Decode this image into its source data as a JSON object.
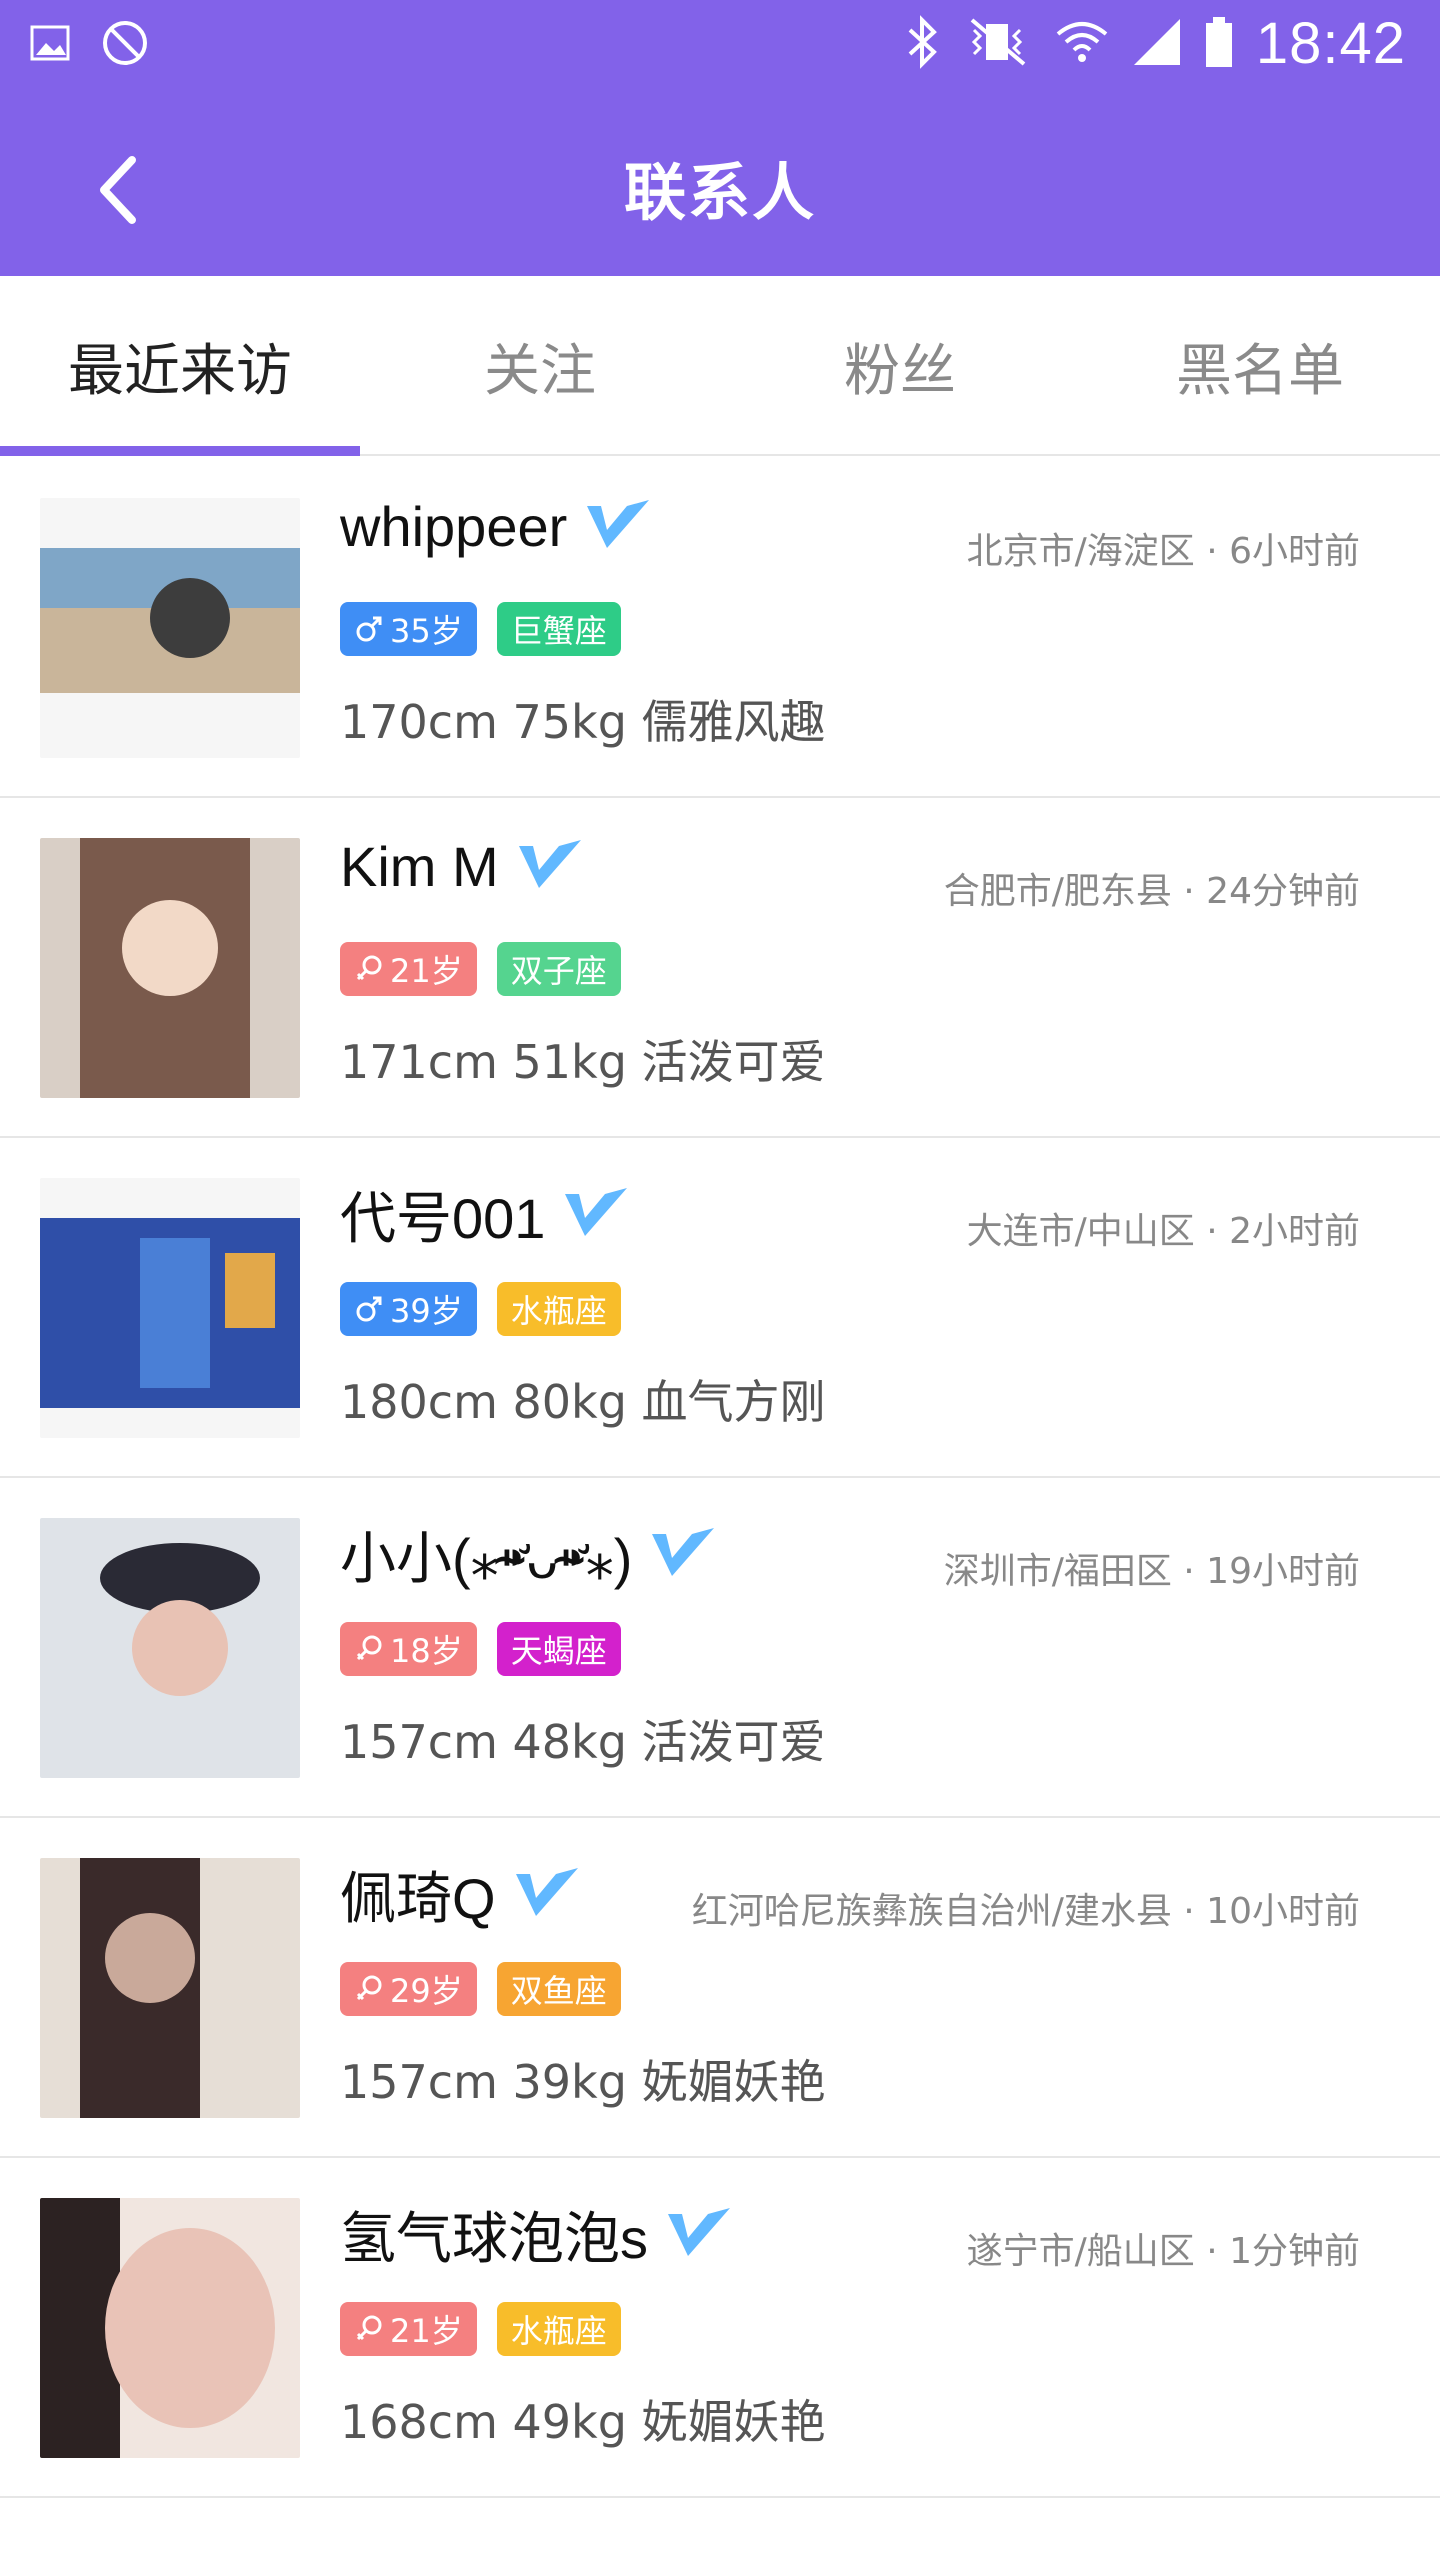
{
  "status_bar": {
    "time": "18:42",
    "icons_left": [
      "image-icon",
      "no-disturb-icon"
    ],
    "icons_right": [
      "bluetooth-icon",
      "vibrate-icon",
      "wifi-icon",
      "signal-icon",
      "battery-icon"
    ]
  },
  "app_bar": {
    "title": "联系人",
    "back_icon": "chevron-left-icon"
  },
  "tabs": [
    {
      "label": "最近来访",
      "active": true
    },
    {
      "label": "关注",
      "active": false
    },
    {
      "label": "粉丝",
      "active": false
    },
    {
      "label": "黑名单",
      "active": false
    }
  ],
  "accent_color": "#8262e9",
  "contacts": [
    {
      "name": "whippeer",
      "verified": true,
      "location": "北京市/海淀区 · 6小时前",
      "gender": "male",
      "age": "35岁",
      "zodiac": "巨蟹座",
      "zodiac_color": "#2ecc87",
      "desc": "170cm 75kg 儒雅风趣",
      "avatar_colors": [
        "#7fa6c7",
        "#c9b59a",
        "#3d3d3d"
      ]
    },
    {
      "name": "Kim M",
      "verified": true,
      "location": "合肥市/肥东县 · 24分钟前",
      "gender": "female",
      "age": "21岁",
      "zodiac": "双子座",
      "zodiac_color": "#55d48f",
      "desc": "171cm 51kg 活泼可爱",
      "avatar_colors": [
        "#d9cfc6",
        "#7a5a4c",
        "#f2d9c7"
      ]
    },
    {
      "name": "代号001",
      "verified": true,
      "location": "大连市/中山区 · 2小时前",
      "gender": "male",
      "age": "39岁",
      "zodiac": "水瓶座",
      "zodiac_color": "#f8bd2a",
      "desc": "180cm 80kg 血气方刚",
      "avatar_colors": [
        "#2f4fa8",
        "#4a7fd6",
        "#e2a84a"
      ]
    },
    {
      "name": "小小(⁎⁍̴̛ᴗ⁍̴̛⁎)",
      "verified": true,
      "location": "深圳市/福田区 · 19小时前",
      "gender": "female",
      "age": "18岁",
      "zodiac": "天蝎座",
      "zodiac_color": "#d321cc",
      "desc": "157cm 48kg 活泼可爱",
      "avatar_colors": [
        "#dfe3e8",
        "#2a2a35",
        "#e8c2b4"
      ]
    },
    {
      "name": "佩琦Q",
      "verified": true,
      "location": "红河哈尼族彝族自治州/建水县 · 10小时前",
      "gender": "female",
      "age": "29岁",
      "zodiac": "双鱼座",
      "zodiac_color": "#f7a532",
      "desc": "157cm 39kg 妩媚妖艳",
      "avatar_colors": [
        "#e6ded6",
        "#3a2a2a",
        "#c9a99a"
      ]
    },
    {
      "name": "氢气球泡泡s",
      "verified": true,
      "location": "遂宁市/船山区 · 1分钟前",
      "gender": "female",
      "age": "21岁",
      "zodiac": "水瓶座",
      "zodiac_color": "#f8bd2a",
      "desc": "168cm 49kg 妩媚妖艳",
      "avatar_colors": [
        "#f1e6e0",
        "#2c2222",
        "#e9c3b7"
      ]
    }
  ]
}
